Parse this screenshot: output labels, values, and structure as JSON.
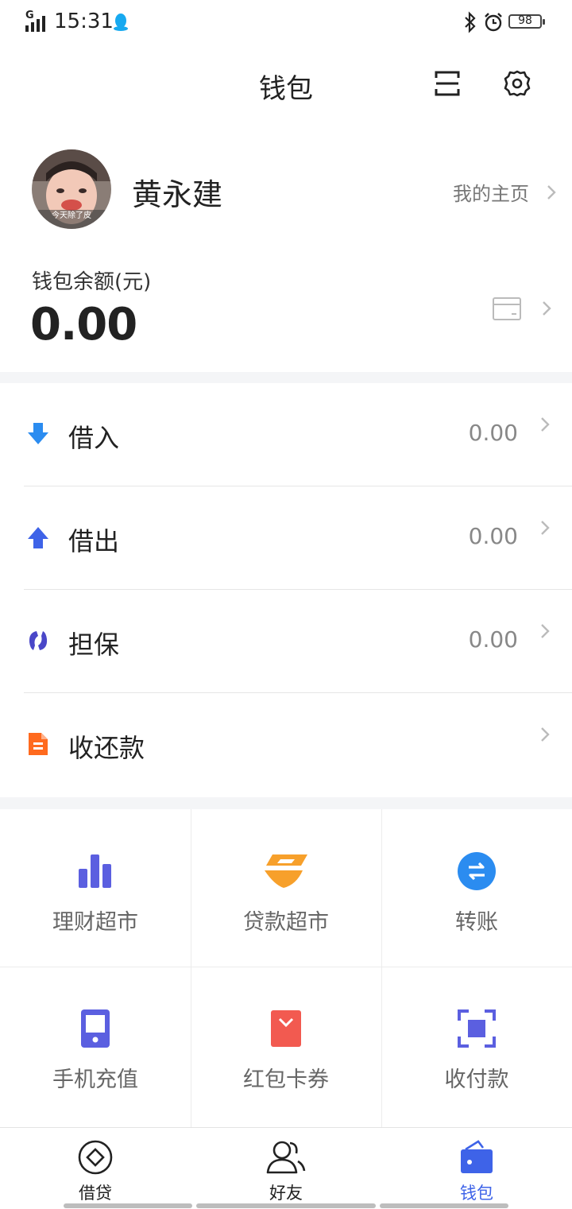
{
  "status_bar": {
    "time": "15:31",
    "signal_label": "G",
    "battery": "98"
  },
  "header": {
    "title": "钱包"
  },
  "profile": {
    "name": "黄永建",
    "home_link": "我的主页",
    "avatar_caption": "今天除了皮"
  },
  "balance": {
    "label": "钱包余额(元)",
    "value": "0.00"
  },
  "list": [
    {
      "label": "借入",
      "value": "0.00",
      "icon": "arrow-down-icon"
    },
    {
      "label": "借出",
      "value": "0.00",
      "icon": "arrow-up-icon"
    },
    {
      "label": "担保",
      "value": "0.00",
      "icon": "guarantee-icon"
    },
    {
      "label": "收还款",
      "value": "",
      "icon": "document-icon"
    }
  ],
  "grid": [
    {
      "label": "理财超市",
      "icon": "bar-chart-icon"
    },
    {
      "label": "贷款超市",
      "icon": "loan-icon"
    },
    {
      "label": "转账",
      "icon": "transfer-icon"
    },
    {
      "label": "手机充值",
      "icon": "phone-icon"
    },
    {
      "label": "红包卡券",
      "icon": "red-envelope-icon"
    },
    {
      "label": "收付款",
      "icon": "scan-pay-icon"
    }
  ],
  "tabs": [
    {
      "label": "借贷",
      "icon": "diamond-icon",
      "active": false
    },
    {
      "label": "好友",
      "icon": "friends-icon",
      "active": false
    },
    {
      "label": "钱包",
      "icon": "wallet-icon",
      "active": true
    }
  ],
  "colors": {
    "accent": "#3e63e8",
    "blue": "#2b8cf0",
    "orange": "#ff6a1e",
    "purple": "#5b5fe0",
    "red": "#f25a50",
    "amber": "#f7a02b"
  }
}
